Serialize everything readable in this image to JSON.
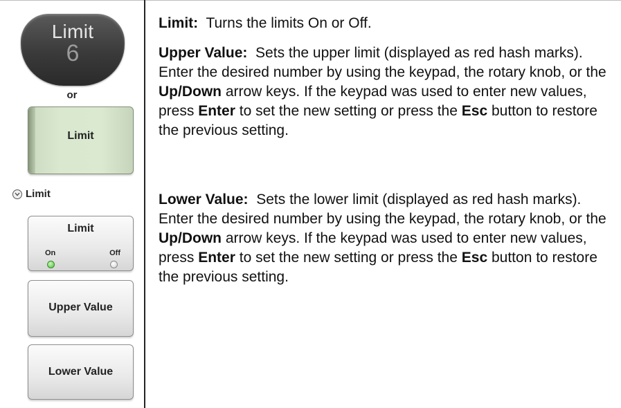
{
  "left_panel": {
    "hardkey": {
      "label": "Limit",
      "number": "6"
    },
    "or_text": "or",
    "main_softkey": {
      "label": "Limit"
    },
    "menu": {
      "title": "Limit",
      "icon": "chevron-down-icon",
      "buttons": {
        "limit_toggle": {
          "label": "Limit",
          "on": "On",
          "off": "Off",
          "state": "On"
        },
        "upper_value": {
          "label": "Upper Value"
        },
        "lower_value": {
          "label": "Lower Value"
        }
      }
    }
  },
  "descriptions": {
    "limit": {
      "term": "Limit:",
      "text": "Turns the limits On or Off."
    },
    "upper_value": {
      "term": "Upper Value:",
      "text_1": "Sets the upper limit (displayed as red hash marks). Enter the desired number by using the keypad, the rotary knob, or the",
      "key_1": "Up/Down",
      "text_2": "arrow keys. If the keypad was used to enter new values, press",
      "key_2": "Enter",
      "text_3": "to set the new setting or press the",
      "key_3": "Esc",
      "text_4": "button to restore the previous setting."
    },
    "lower_value": {
      "term": "Lower Value:",
      "text_1": "Sets the lower limit (displayed as red hash marks). Enter the desired number by using the keypad, the rotary knob, or the",
      "key_1": "Up/Down",
      "text_2": "arrow keys. If the keypad was used to enter new values, press",
      "key_2": "Enter",
      "text_3": "to set the new setting or press the",
      "key_3": "Esc",
      "text_4": "button to restore the previous setting."
    }
  },
  "colors": {
    "led_on": "#4fc13a",
    "softkey_green": "#d9e8cf",
    "hardkey": "#3a3a3a"
  }
}
